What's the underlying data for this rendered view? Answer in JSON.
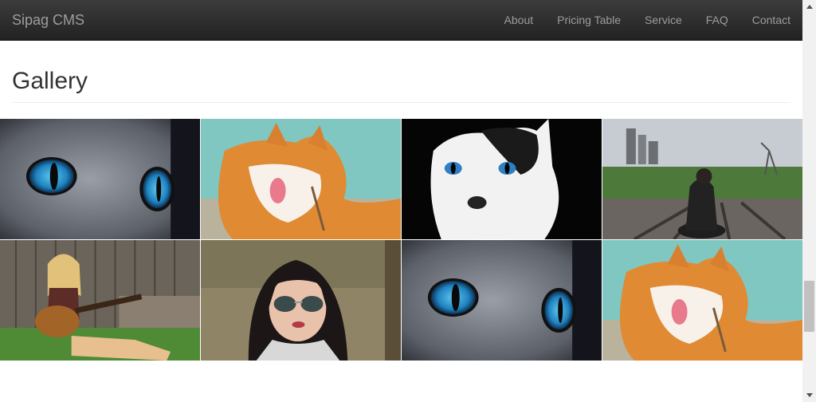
{
  "navbar": {
    "brand": "Sipag CMS",
    "links": [
      "About",
      "Pricing Table",
      "Service",
      "FAQ",
      "Contact"
    ]
  },
  "gallery": {
    "title": "Gallery",
    "images": [
      "cat-blue-eyes-closeup",
      "orange-cat-licking",
      "black-white-cat",
      "woman-on-railway",
      "woman-with-guitar",
      "woman-with-sunglasses",
      "cat-blue-eyes-closeup",
      "orange-cat-licking"
    ]
  },
  "colors": {
    "navbar_top": "#3c3c3c",
    "navbar_bottom": "#222222",
    "nav_text": "#9d9d9d",
    "heading": "#333333"
  }
}
